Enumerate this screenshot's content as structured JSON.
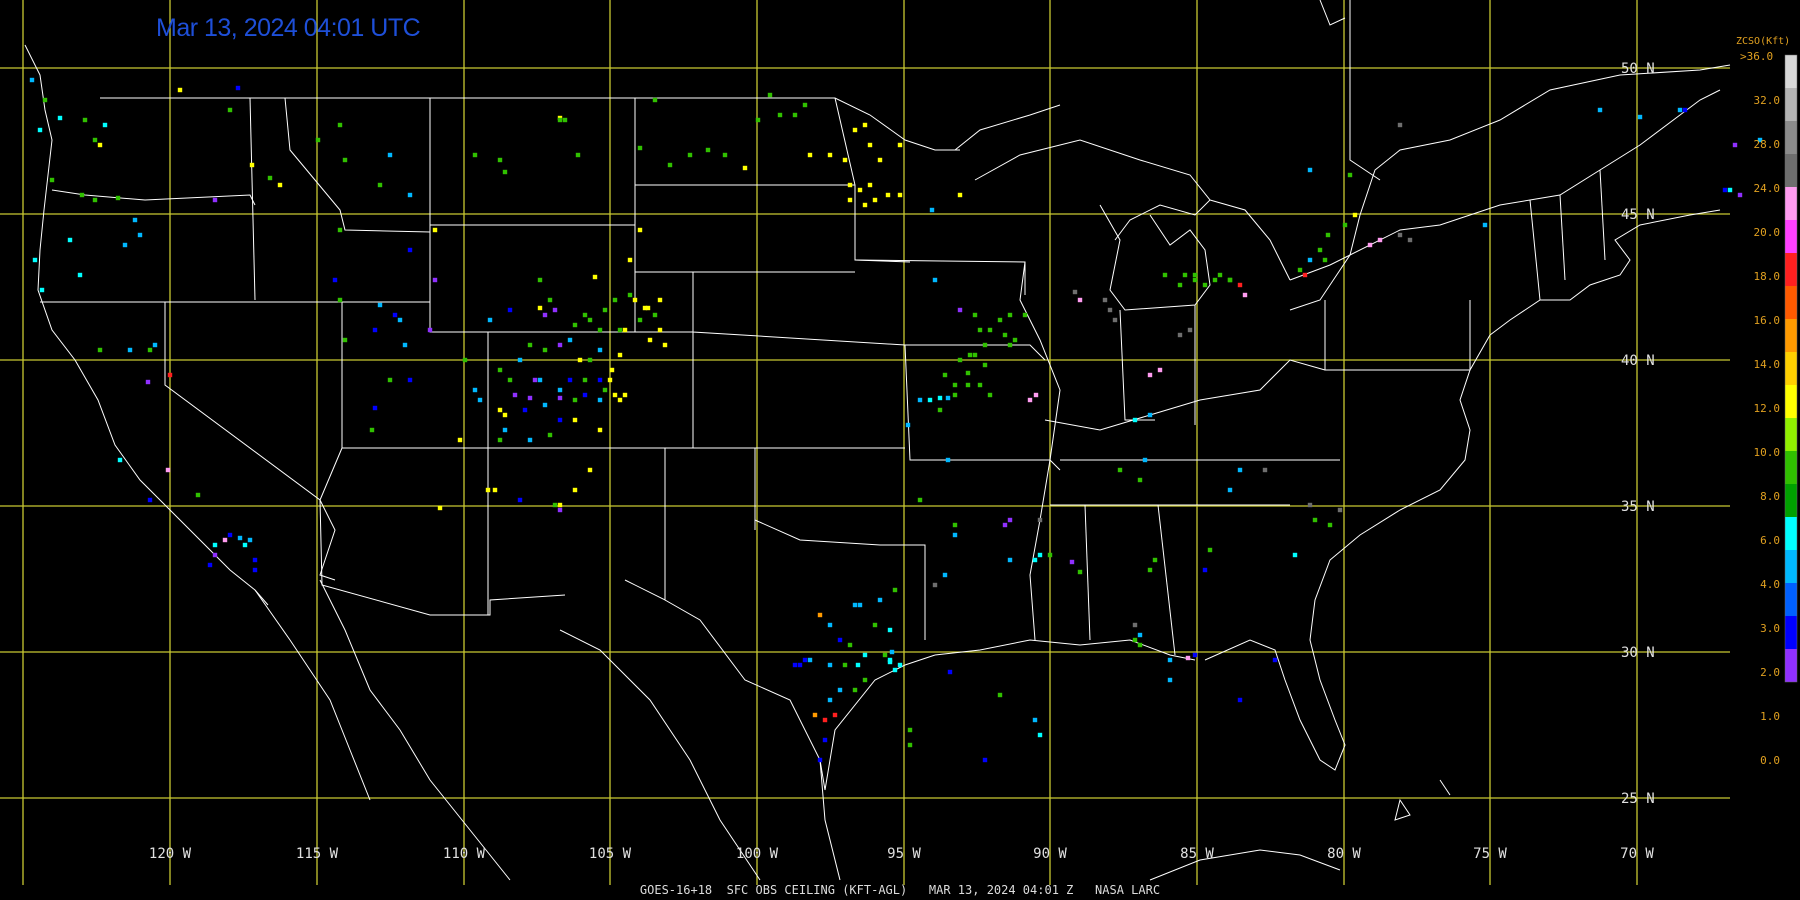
{
  "timestamp": "Mar 13, 2024 04:01 UTC",
  "footer": "GOES-16+18  SFC OBS CEILING (KFT-AGL)   MAR 13, 2024 04:01 Z   NASA LARC",
  "legend": {
    "title": "ZCSO(Kft)",
    "top_label": ">36.0",
    "labels": [
      "32.0",
      "28.0",
      "24.0",
      "20.0",
      "18.0",
      "16.0",
      "14.0",
      "12.0",
      "10.0",
      "8.0",
      "6.0",
      "4.0",
      "3.0",
      "2.0",
      "1.0",
      "0.0"
    ],
    "colors": [
      "#d8d8d8",
      "#b4b4b4",
      "#8c8c8c",
      "#6e6e6e",
      "#ff9cf0",
      "#ff40ff",
      "#ff2020",
      "#ff5a00",
      "#ff9a00",
      "#ffd000",
      "#ffff00",
      "#90f000",
      "#30c000",
      "#00a000",
      "#00ffff",
      "#00b8ff",
      "#0060ff",
      "#0000ff",
      "#9030ff"
    ]
  },
  "lat_labels": [
    "50 N",
    "45 N",
    "40 N",
    "35 N",
    "30 N",
    "25 N"
  ],
  "lon_labels": [
    "120 W",
    "115 W",
    "110 W",
    "105 W",
    "100 W",
    "95 W",
    "90 W",
    "85 W",
    "80 W",
    "75 W",
    "70 W"
  ],
  "colors": {
    "grid": "#c8c832",
    "border": "#ffffff",
    "stamp": "#1e4fd8"
  }
}
